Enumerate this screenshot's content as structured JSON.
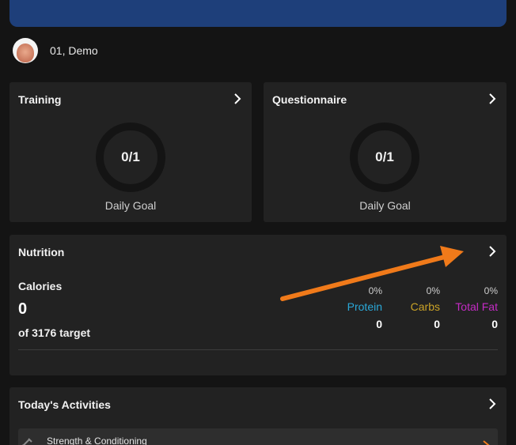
{
  "profile": {
    "name": "01, Demo"
  },
  "training": {
    "title": "Training",
    "progress": "0/1",
    "goal_label": "Daily Goal"
  },
  "questionnaire": {
    "title": "Questionnaire",
    "progress": "0/1",
    "goal_label": "Daily Goal"
  },
  "nutrition": {
    "title": "Nutrition",
    "calories_label": "Calories",
    "calories_value": "0",
    "target_text": "of 3176 target",
    "macros": [
      {
        "name": "Protein",
        "pct": "0%",
        "value": "0",
        "color": "#2aa8d8"
      },
      {
        "name": "Carbs",
        "pct": "0%",
        "value": "0",
        "color": "#c9a227"
      },
      {
        "name": "Total Fat",
        "pct": "0%",
        "value": "0",
        "color": "#c42bc4"
      }
    ]
  },
  "activities": {
    "title": "Today's Activities",
    "items": [
      {
        "label": "Strength & Conditioning",
        "icon": "dumbbell-icon"
      }
    ]
  },
  "colors": {
    "banner": "#1e3f7a",
    "card": "#222222",
    "annotation_arrow": "#f07a1a"
  }
}
